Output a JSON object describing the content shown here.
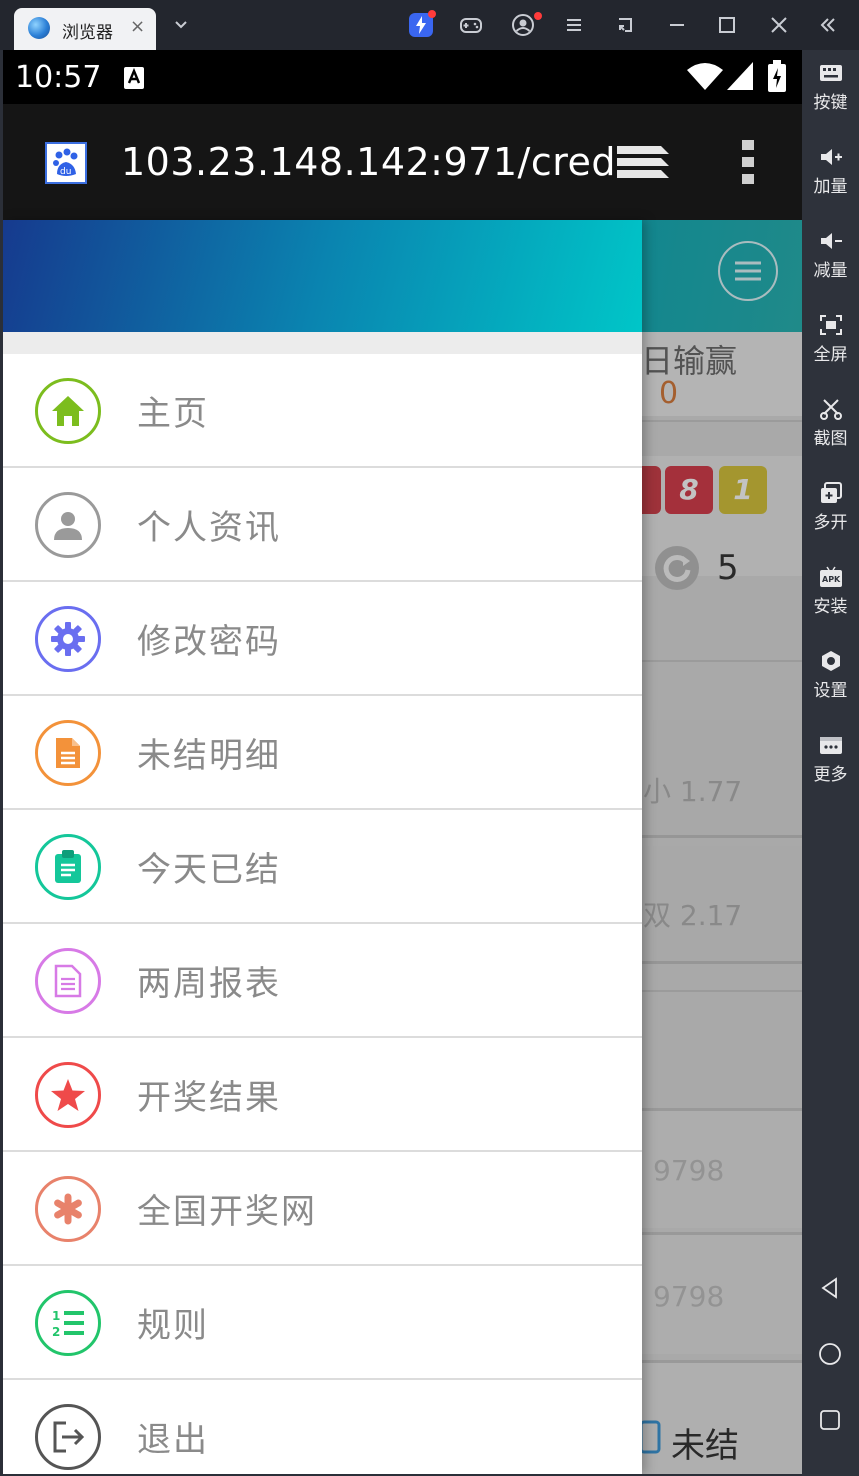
{
  "window": {
    "tab_label": "浏览器",
    "tab_close": "×",
    "tab_dropdown": "⌄"
  },
  "toolbar": {
    "items": [
      {
        "label": "按键",
        "icon": "keyboard-icon"
      },
      {
        "label": "加量",
        "icon": "volume-up-icon"
      },
      {
        "label": "减量",
        "icon": "volume-down-icon"
      },
      {
        "label": "全屏",
        "icon": "fullscreen-icon"
      },
      {
        "label": "截图",
        "icon": "scissors-icon"
      },
      {
        "label": "多开",
        "icon": "multi-instance-icon"
      },
      {
        "label": "安装",
        "icon": "apk-install-icon"
      },
      {
        "label": "设置",
        "icon": "settings-icon"
      },
      {
        "label": "更多",
        "icon": "more-icon"
      }
    ]
  },
  "status_bar": {
    "time": "10:57"
  },
  "browser": {
    "url": "103.23.148.142:971/cred"
  },
  "background_page": {
    "header_label": "日输赢",
    "header_value": "0",
    "ball_1": "8",
    "ball_2": "1",
    "refresh_count": "5",
    "odds_1": "小 1.77",
    "odds_2": "双 2.17",
    "num_1": "9798",
    "num_2": "9798",
    "bottom_tab": "未结"
  },
  "drawer": {
    "items": [
      {
        "label": "主页",
        "icon": "home-icon",
        "color": "#7cbd1e"
      },
      {
        "label": "个人资讯",
        "icon": "user-icon",
        "color": "#9a9a9a"
      },
      {
        "label": "修改密码",
        "icon": "gear-icon",
        "color": "#6a6ef0"
      },
      {
        "label": "未结明细",
        "icon": "document-icon",
        "color": "#f3923a"
      },
      {
        "label": "今天已结",
        "icon": "clipboard-icon",
        "color": "#14c79a"
      },
      {
        "label": "两周报表",
        "icon": "report-icon",
        "color": "#d77ae6"
      },
      {
        "label": "开奖结果",
        "icon": "star-icon",
        "color": "#ef4a4a"
      },
      {
        "label": "全国开奖网",
        "icon": "asterisk-icon",
        "color": "#e8826b"
      },
      {
        "label": "规则",
        "icon": "numbered-list-icon",
        "color": "#22c56b"
      },
      {
        "label": "退出",
        "icon": "logout-icon",
        "color": "#555555"
      }
    ]
  }
}
